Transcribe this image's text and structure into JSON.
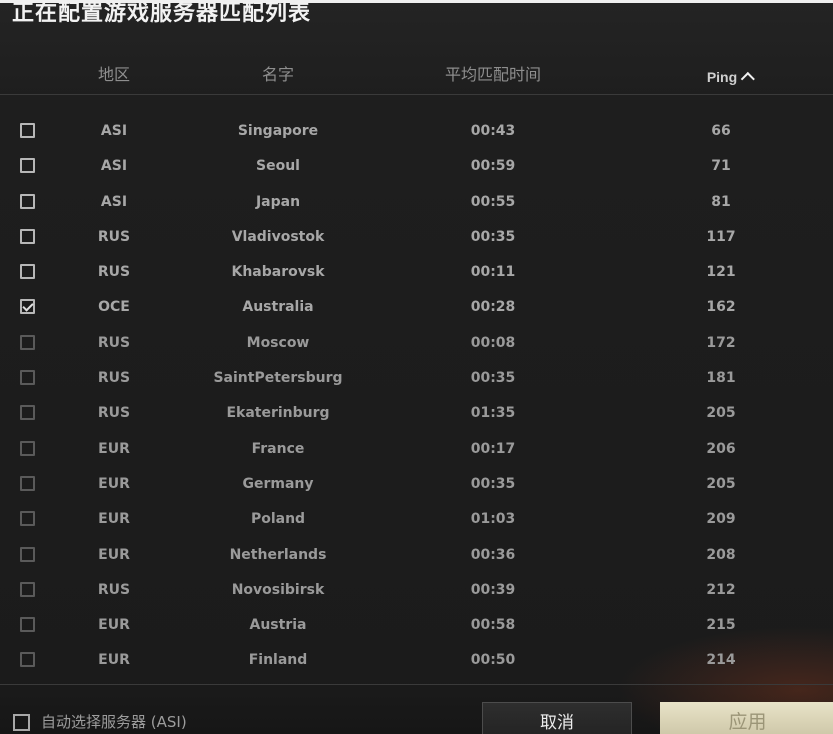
{
  "title": "正在配置游戏服务器匹配列表",
  "header": {
    "region": "地区",
    "name": "名字",
    "avg_time": "平均匹配时间",
    "ping": "Ping"
  },
  "servers": [
    {
      "region": "ASI",
      "name": "Singapore",
      "time": "00:43",
      "ping": "66",
      "checked": false,
      "dim": false
    },
    {
      "region": "ASI",
      "name": "Seoul",
      "time": "00:59",
      "ping": "71",
      "checked": false,
      "dim": false
    },
    {
      "region": "ASI",
      "name": "Japan",
      "time": "00:55",
      "ping": "81",
      "checked": false,
      "dim": false
    },
    {
      "region": "RUS",
      "name": "Vladivostok",
      "time": "00:35",
      "ping": "117",
      "checked": false,
      "dim": false
    },
    {
      "region": "RUS",
      "name": "Khabarovsk",
      "time": "00:11",
      "ping": "121",
      "checked": false,
      "dim": false
    },
    {
      "region": "OCE",
      "name": "Australia",
      "time": "00:28",
      "ping": "162",
      "checked": true,
      "dim": false
    },
    {
      "region": "RUS",
      "name": "Moscow",
      "time": "00:08",
      "ping": "172",
      "checked": false,
      "dim": true
    },
    {
      "region": "RUS",
      "name": "SaintPetersburg",
      "time": "00:35",
      "ping": "181",
      "checked": false,
      "dim": true
    },
    {
      "region": "RUS",
      "name": "Ekaterinburg",
      "time": "01:35",
      "ping": "205",
      "checked": false,
      "dim": true
    },
    {
      "region": "EUR",
      "name": "France",
      "time": "00:17",
      "ping": "206",
      "checked": false,
      "dim": true
    },
    {
      "region": "EUR",
      "name": "Germany",
      "time": "00:35",
      "ping": "205",
      "checked": false,
      "dim": true
    },
    {
      "region": "EUR",
      "name": "Poland",
      "time": "01:03",
      "ping": "209",
      "checked": false,
      "dim": true
    },
    {
      "region": "EUR",
      "name": "Netherlands",
      "time": "00:36",
      "ping": "208",
      "checked": false,
      "dim": true
    },
    {
      "region": "RUS",
      "name": "Novosibirsk",
      "time": "00:39",
      "ping": "212",
      "checked": false,
      "dim": true
    },
    {
      "region": "EUR",
      "name": "Austria",
      "time": "00:58",
      "ping": "215",
      "checked": false,
      "dim": true
    },
    {
      "region": "EUR",
      "name": "Finland",
      "time": "00:50",
      "ping": "214",
      "checked": false,
      "dim": true
    }
  ],
  "footer": {
    "auto_select_label": "自动选择服务器 (ASI)",
    "cancel_label": "取消",
    "apply_label": "应用"
  },
  "icons": {
    "sort": "chevron-up-icon",
    "check": "checkmark-icon"
  }
}
